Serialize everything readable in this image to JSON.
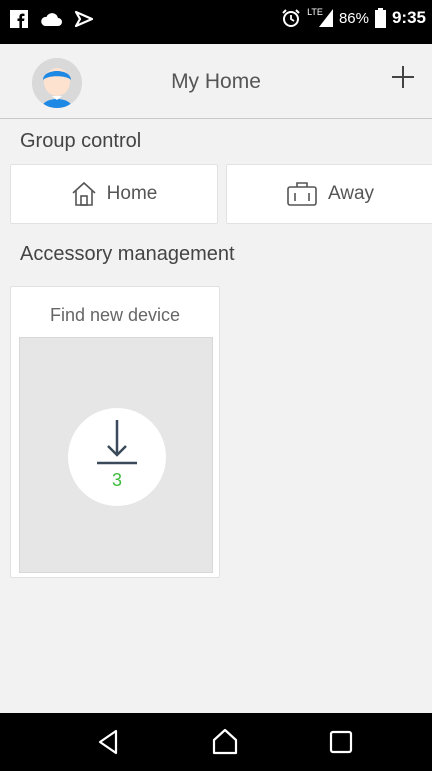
{
  "status_bar": {
    "battery": "86%",
    "time": "9:35",
    "network": "LTE",
    "icons": [
      "facebook-icon",
      "cloud-icon",
      "tasker-icon",
      "alarm-icon",
      "signal-icon",
      "battery-icon"
    ]
  },
  "header": {
    "title": "My Home",
    "avatar_icon": "avatar-icon",
    "add_icon": "plus-icon"
  },
  "group_control": {
    "title": "Group control",
    "buttons": [
      {
        "label": "Home",
        "icon": "home-icon"
      },
      {
        "label": "Away",
        "icon": "suitcase-icon"
      }
    ]
  },
  "accessory_management": {
    "title": "Accessory management",
    "find_card": {
      "label": "Find new device",
      "count": "3",
      "icon": "download-icon"
    }
  },
  "colors": {
    "background": "#f2f2f2",
    "count_green": "#3dbb3d",
    "avatar_blue": "#1e88e5"
  }
}
